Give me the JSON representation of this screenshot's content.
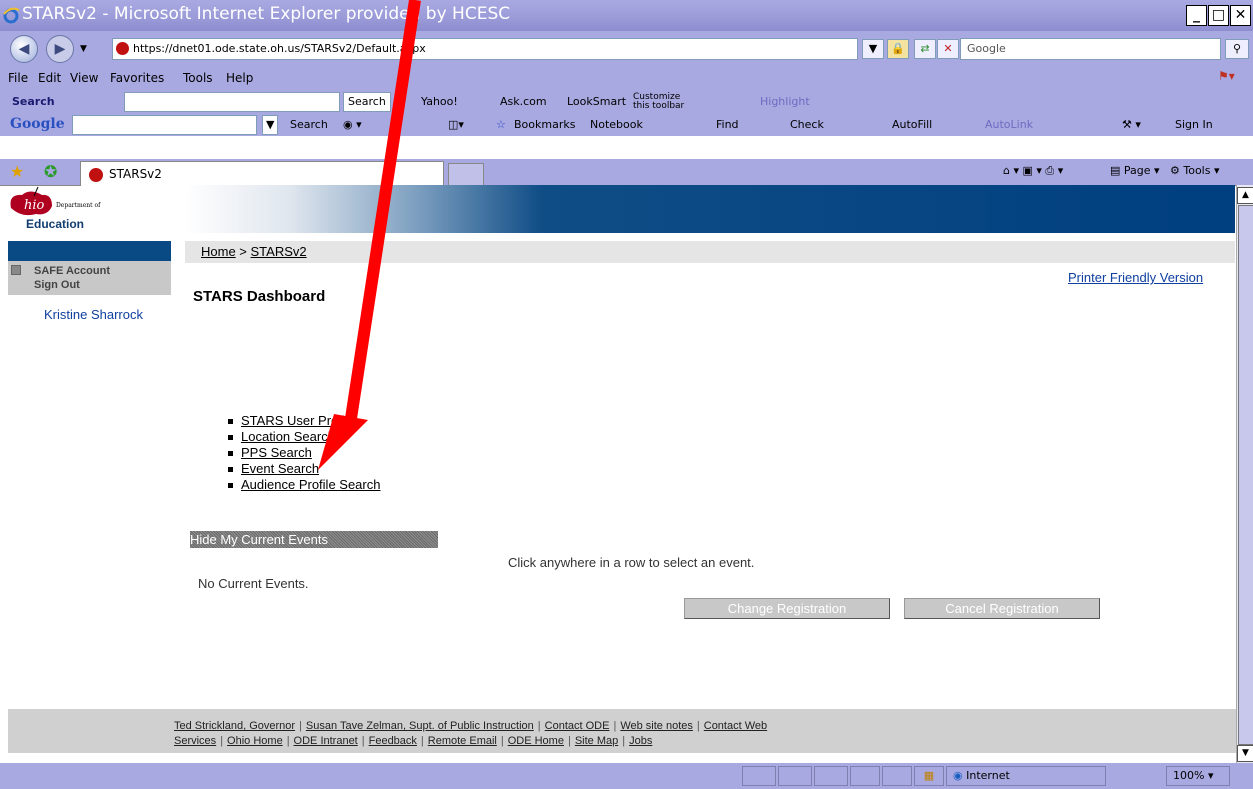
{
  "window": {
    "title": "STARSv2 - Microsoft Internet Explorer provided by HCESC",
    "url": "https://dnet01.ode.state.oh.us/STARSv2/Default.aspx",
    "search_placeholder": "Google"
  },
  "menu": [
    "File",
    "Edit",
    "View",
    "Favorites",
    "Tools",
    "Help"
  ],
  "toolbar1": {
    "mysearch": "Search",
    "search_btn": "Search",
    "yahoo": "Yahoo!",
    "ask": "Ask.com",
    "looksmart": "LookSmart",
    "customize": "Customize this toolbar",
    "highlight": "Highlight"
  },
  "toolbar2": {
    "search": "Search",
    "bookmarks": "Bookmarks",
    "notebook": "Notebook",
    "find": "Find",
    "check": "Check",
    "autofill": "AutoFill",
    "autolink": "AutoLink",
    "signin": "Sign In"
  },
  "tab": {
    "label": "STARSv2"
  },
  "cmdbar": {
    "page": "Page",
    "tools": "Tools"
  },
  "logo": {
    "line1": "Department of",
    "line2": "Education"
  },
  "breadcrumb": {
    "home": "Home",
    "sep": " > ",
    "current": "STARSv2"
  },
  "sidebar": {
    "safe": "SAFE Account",
    "signout": "Sign Out",
    "user": "Kristine Sharrock"
  },
  "printer_friendly": "Printer Friendly Version",
  "page_title": "STARS Dashboard",
  "links": [
    "STARS User Profile",
    "Location Search",
    "PPS Search",
    "Event Search",
    "Audience Profile Search"
  ],
  "events": {
    "hide_label": "Hide My Current Events",
    "hint": "Click anywhere in a row to select an event.",
    "empty": "No Current Events.",
    "change_btn": "Change Registration",
    "cancel_btn": "Cancel Registration"
  },
  "footer": {
    "line1": [
      "Ted Strickland, Governor",
      "Susan Tave Zelman, Supt. of Public Instruction",
      "Contact ODE",
      "Web site notes",
      "Contact Web"
    ],
    "line2": [
      "Services",
      "Ohio Home",
      "ODE Intranet",
      "Feedback",
      "Remote Email",
      "ODE Home",
      "Site Map",
      "Jobs"
    ]
  },
  "status": {
    "zone": "Internet",
    "zoom": "100%"
  },
  "colors": {
    "chrome": "#a9a9e2",
    "banner": "#003f80",
    "arrow": "#ff0000"
  }
}
